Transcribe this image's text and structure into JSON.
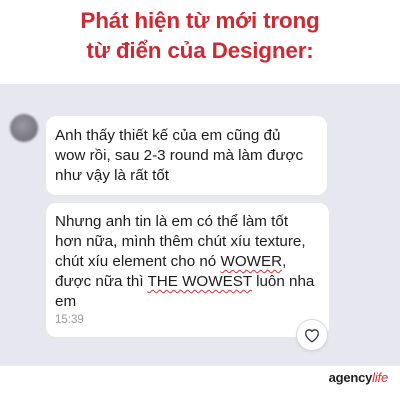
{
  "headline": {
    "line1": "Phát hiện từ mới trong",
    "line2": "từ điển của Designer:"
  },
  "chat": {
    "message1": {
      "lines": [
        "Anh thấy thiết kế của em cũng đủ",
        "wow rồi, sau 2-3 round mà làm được",
        "như vậy là rất tốt"
      ]
    },
    "message2": {
      "line1": "Nhưng anh tin là em có thể làm tốt",
      "line2": "hơn nữa, mình thêm chút xíu texture,",
      "line3_prefix": "chút xíu element cho nó ",
      "line3_highlight": "WOWER",
      "line3_suffix": ",",
      "line4_prefix": "được nữa thì ",
      "line4_highlight": "THE WOWEST",
      "line4_suffix": " luôn nha",
      "line5": "em",
      "time": "15:39"
    },
    "reaction_icon": "heart-outline-icon",
    "accent_color": "#cc2b33",
    "chat_background": "#e6e7ef"
  },
  "logo": {
    "part1": "agency",
    "part2": "life"
  }
}
